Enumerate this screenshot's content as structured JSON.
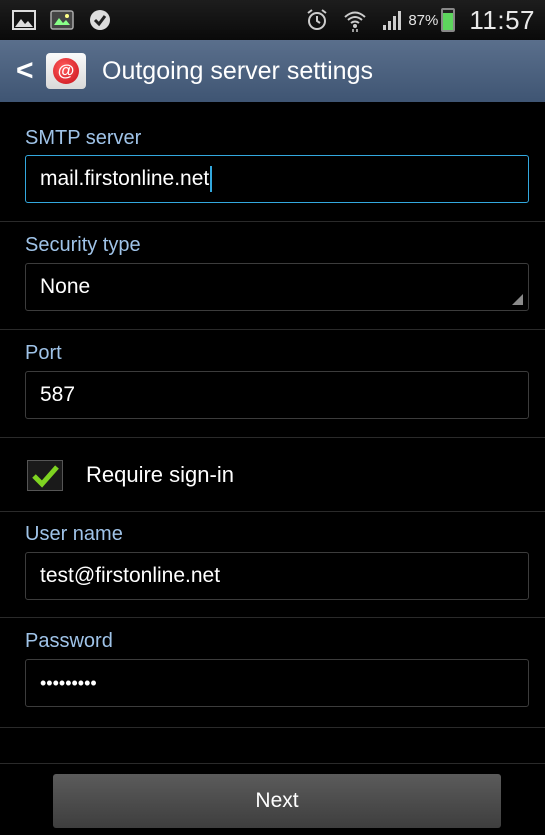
{
  "status_bar": {
    "icons_left": [
      "gallery-icon",
      "photo-icon",
      "check-circle-icon"
    ],
    "icons_right": [
      "alarm-icon",
      "wifi-icon",
      "signal-icon"
    ],
    "battery_percent": "87%",
    "battery_level": 0.87,
    "battery_color": "#5dd55d",
    "time": "11:57"
  },
  "action_bar": {
    "back": "<",
    "app_icon": "@",
    "title": "Outgoing server settings"
  },
  "form": {
    "smtp": {
      "label": "SMTP server",
      "value": "mail.firstonline.net"
    },
    "security": {
      "label": "Security type",
      "value": "None"
    },
    "port": {
      "label": "Port",
      "value": "587"
    },
    "require_signin": {
      "label": "Require sign-in",
      "checked": true
    },
    "username": {
      "label": "User name",
      "value": "test@firstonline.net"
    },
    "password": {
      "label": "Password",
      "value": "•••••••••"
    }
  },
  "next_button": {
    "label": "Next"
  },
  "colors": {
    "label": "#9fc3e8",
    "focus": "#33a8de",
    "action_bar": "#4c6281",
    "check": "#7ed321"
  }
}
